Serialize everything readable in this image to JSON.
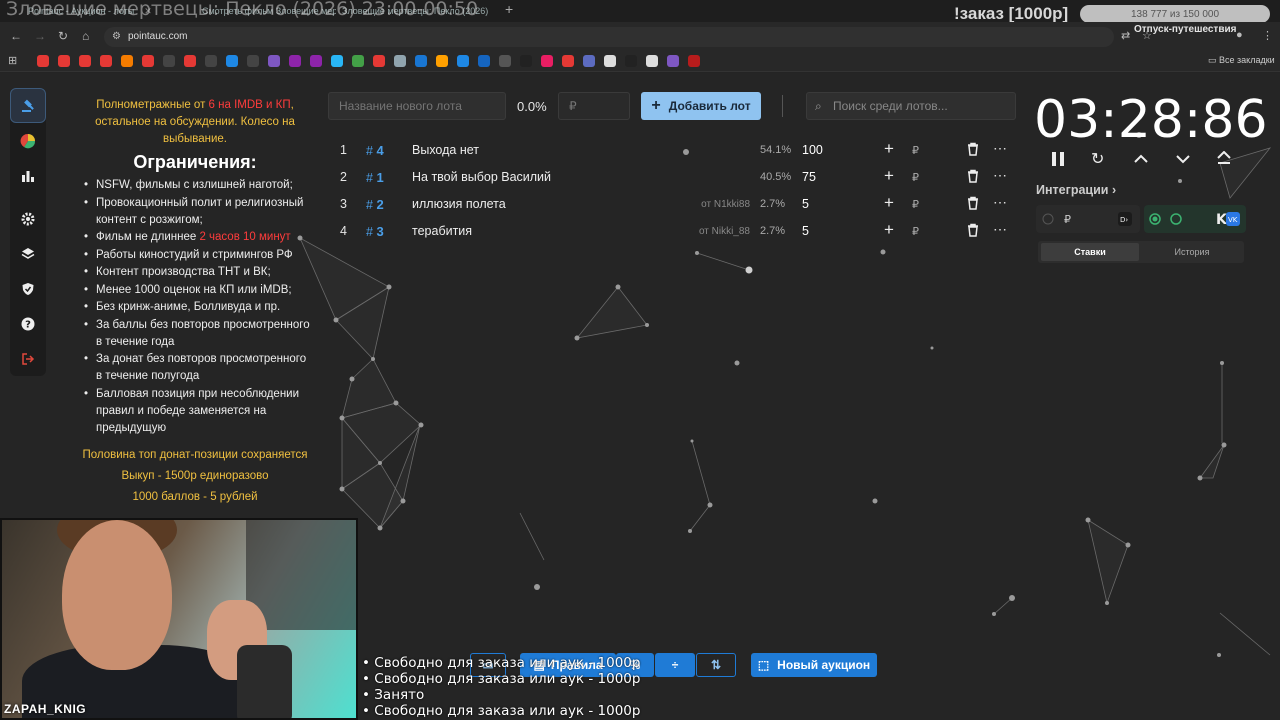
{
  "browser": {
    "tabs": [
      {
        "label": "Pointauc - Аукцион - лоты"
      },
      {
        "label": "Смотреть фильм Зловещие мертвецы"
      },
      {
        "label": "Зловещие мертвецы: Пекло (2026)"
      }
    ],
    "stream_title": "Зловещие мертвецы: Пекло (2026) 23:00-00:50",
    "url": "pointauc.com",
    "order_label": "!заказ [1000р]",
    "goal": "138 777 из 150 000",
    "goal_fraction": 0.925,
    "vacation_label": "Отпуск-путешествия",
    "bookmarks_label": "Все закладки"
  },
  "rules": {
    "intro_part1": "Полнометражные от ",
    "intro_red": "6 на IMDB и КП",
    "intro_part2": ", остальное на обсуждении. Колесо на выбывание.",
    "heading": "Ограничения:",
    "items": [
      "NSFW, фильмы с излишней наготой;",
      "Провокационный полит и религиозный контент с розжигом;",
      "Фильм не длиннее ",
      "Работы киностудий и стримингов РФ",
      "Контент производства ТНТ и ВК;",
      "Менее 1000 оценок на КП или iMDB;",
      "Без кринж-аниме, Болливуда и пр.",
      "За баллы без повторов просмотренного в течение года",
      "За донат без повторов просмотренного в течение полугода",
      "Балловая позиция при несоблюдении правил и победе заменяется на предыдущую"
    ],
    "item3_red": "2 часов 10 минут",
    "footer": [
      "Половина топ донат-позиции сохраняется",
      "Выкуп - 1500р единоразово",
      "1000 баллов - 5 рублей"
    ]
  },
  "webcam": {
    "username": "ZAPAH_KNIG"
  },
  "lot_input": {
    "name_placeholder": "Название нового лота",
    "percent": "0.0%",
    "amount_placeholder": "₽",
    "add_label": "Добавить лот",
    "search_placeholder": "Поиск среди лотов..."
  },
  "lots": [
    {
      "index": "1",
      "fast_id": "4",
      "name": "Выхода нет",
      "from": "",
      "percent": "54.1%",
      "amount": "100"
    },
    {
      "index": "2",
      "fast_id": "1",
      "name": "На твой выбор Василий",
      "from": "",
      "percent": "40.5%",
      "amount": "75"
    },
    {
      "index": "3",
      "fast_id": "2",
      "name": "иллюзия полета",
      "from": "от N1kki88",
      "percent": "2.7%",
      "amount": "5"
    },
    {
      "index": "4",
      "fast_id": "3",
      "name": "терабития",
      "from": "от Nikki_88",
      "percent": "2.7%",
      "amount": "5"
    }
  ],
  "currency_symbol": "₽",
  "hash_symbol": "#",
  "timer": {
    "value": "03:28:86"
  },
  "integrations": {
    "label": "Интеграции",
    "tabs": [
      "Ставки",
      "История"
    ],
    "active_tab": "Ставки"
  },
  "bottom_toolbar": {
    "rules_label": "Правила",
    "new_auction_label": "Новый аукцион"
  },
  "overlay_lines": [
    "Свободно для заказа или аук - 1000р",
    "Свободно для заказа или аук - 1000р",
    "Занято",
    "Свободно для заказа или аук - 1000р"
  ],
  "colors": {
    "accent": "#1f7bd6",
    "add_button": "#8fc3f0",
    "yellow_text": "#f0c040",
    "red_text": "#ff3c3c",
    "fast_id": "#4a9ee8"
  }
}
